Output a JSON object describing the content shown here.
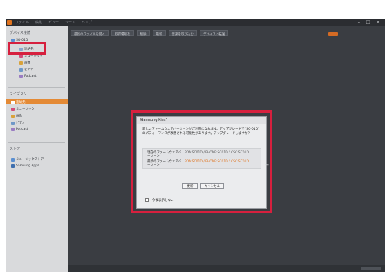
{
  "titlebar": {
    "menu": [
      "ファイル",
      "編集",
      "ビュー",
      "ツール",
      "ヘルプ"
    ],
    "window_controls": "– □ ×"
  },
  "toolbar": {
    "buttons": [
      "最新のファイルを開く",
      "取得場所を",
      "削除",
      "最新",
      "音楽を取り込む",
      "デバイスに転送"
    ]
  },
  "sidebar": {
    "devices_header": "デバイス接続",
    "device": {
      "name": "SO-01D",
      "items": [
        "連絡先",
        "ミュージック",
        "画像",
        "ビデオ",
        "Podcast"
      ]
    },
    "library_header": "ライブラリー",
    "library_items": [
      "連絡先",
      "ミュージック",
      "画像",
      "ビデオ",
      "Podcast"
    ],
    "store_header": "ストア",
    "store_items": [
      "ミュージックストア",
      "Samsung Apps"
    ]
  },
  "dialog": {
    "title": "\"Samsung Kies\"",
    "close": "×",
    "message": "新しいファームウェアバージョンがご利用になれます。アップグレードで 'SC-01D' のパフォーマンスが改善される可能性があります。アップグレードしますか？",
    "current_label": "現在のファームウェアバージョン",
    "current_value": "PDA:SC01D / PHONE:SC01D / CSC:SC01D",
    "latest_label": "最新のファームウェアバージョン",
    "latest_value": "PDA:SC01D / PHONE:SC01D / CSC:SC01D",
    "update_button": "更新",
    "cancel_button": "キャンセル",
    "checkbox_label": "今後表示しない"
  },
  "colors": {
    "accent": "#d6203e",
    "selection": "#e48a36",
    "app_background": "#3a3d42"
  }
}
